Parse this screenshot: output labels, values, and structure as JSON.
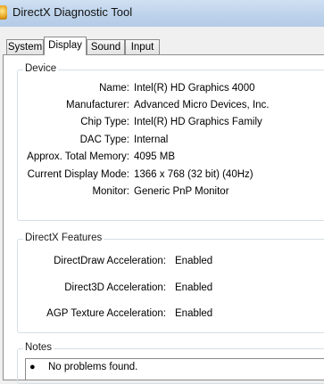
{
  "window": {
    "title": "DirectX Diagnostic Tool"
  },
  "tabs": [
    {
      "label": "System"
    },
    {
      "label": "Display"
    },
    {
      "label": "Sound"
    },
    {
      "label": "Input"
    }
  ],
  "device": {
    "title": "Device",
    "fields": [
      {
        "label": "Name:",
        "value": "Intel(R) HD Graphics 4000"
      },
      {
        "label": "Manufacturer:",
        "value": "Advanced Micro Devices, Inc."
      },
      {
        "label": "Chip Type:",
        "value": "Intel(R) HD Graphics Family"
      },
      {
        "label": "DAC Type:",
        "value": "Internal"
      },
      {
        "label": "Approx. Total Memory:",
        "value": "4095 MB"
      },
      {
        "label": "Current Display Mode:",
        "value": "1366 x 768 (32 bit) (40Hz)"
      },
      {
        "label": "Monitor:",
        "value": "Generic PnP Monitor"
      }
    ]
  },
  "features": {
    "title": "DirectX Features",
    "fields": [
      {
        "label": "DirectDraw Acceleration:",
        "value": "Enabled"
      },
      {
        "label": "Direct3D Acceleration:",
        "value": "Enabled"
      },
      {
        "label": "AGP Texture Acceleration:",
        "value": "Enabled"
      }
    ]
  },
  "notes": {
    "title": "Notes",
    "items": [
      "No problems found."
    ]
  }
}
